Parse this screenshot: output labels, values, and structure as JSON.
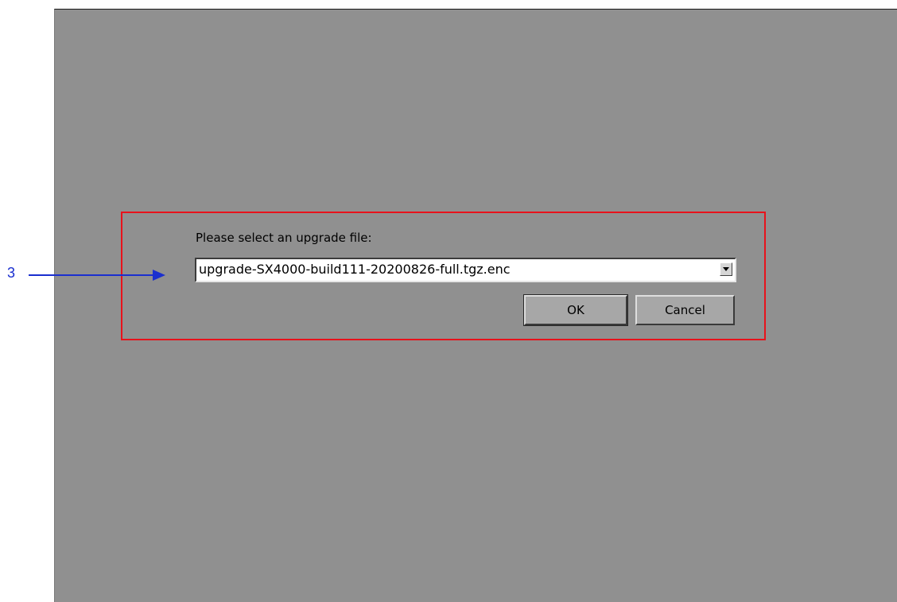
{
  "dialog": {
    "prompt": "Please select an upgrade file:",
    "selected_file": "upgrade-SX4000-build111-20200826-full.tgz.enc",
    "ok_label": "OK",
    "cancel_label": "Cancel"
  },
  "annotation": {
    "step_number": "3",
    "highlight_color": "#e8121b",
    "arrow_color": "#1a2fcf"
  },
  "icons": {
    "dropdown": "chevron-down-icon",
    "callout": "arrow-right-icon"
  },
  "colors": {
    "screen_background": "#909090",
    "button_face": "#a7a7a7",
    "input_background": "#ffffff"
  }
}
